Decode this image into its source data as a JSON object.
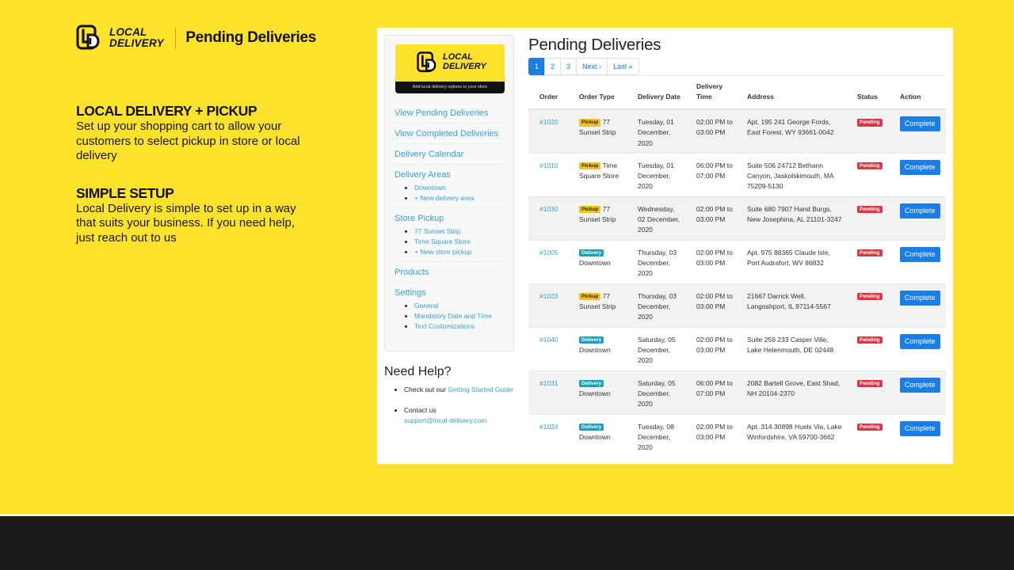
{
  "brand": {
    "logo_text_line1": "LOCAL",
    "logo_text_line2": "DELIVERY",
    "title": "Pending Deliveries"
  },
  "features": [
    {
      "heading": "LOCAL DELIVERY + PICKUP",
      "body": "Set up your shopping cart to allow your customers to select pickup in store or local delivery"
    },
    {
      "heading": "SIMPLE SETUP",
      "body": "Local Delivery is simple to set up in a way that suits your business. If you need help, just reach out to us"
    }
  ],
  "app": {
    "sidebar_logo": {
      "line1": "LOCAL",
      "line2": "DELIVERY",
      "tagline": "Add local delivery options to your store"
    },
    "nav": [
      {
        "label": "View Pending Deliveries",
        "children": []
      },
      {
        "label": "View Completed Deliveries",
        "children": []
      },
      {
        "label": "Delivery Calendar",
        "children": []
      },
      {
        "label": "Delivery Areas",
        "children": [
          "Downtown",
          "+ New delivery area"
        ]
      },
      {
        "label": "Store Pickup",
        "children": [
          "77 Sunset Strip",
          "Time Square Store",
          "+ New store pickup"
        ]
      },
      {
        "label": "Products",
        "children": []
      },
      {
        "label": "Settings",
        "children": [
          "General",
          "Mandatory Date and Time",
          "Text Customizations"
        ]
      }
    ],
    "help": {
      "title": "Need Help?",
      "item1_prefix": "Check out our ",
      "item1_link": "Getting Started Guide",
      "item2_prefix": "Contact us",
      "item2_link": "support@local-delivery.com"
    },
    "page_title": "Pending Deliveries",
    "pagination": {
      "pages": [
        "1",
        "2",
        "3"
      ],
      "active": "1",
      "next": "Next ›",
      "last": "Last »"
    },
    "table": {
      "headers": [
        "Order",
        "Order Type",
        "Delivery Date",
        "Delivery Time",
        "Address",
        "Status",
        "Action"
      ],
      "rows": [
        {
          "order": "#1020",
          "type": "Pickup",
          "type_detail": "77 Sunset Strip",
          "date": "Tuesday, 01 December, 2020",
          "time": "02:00 PM to 03:00 PM",
          "address": "Apt. 195 241 George Fords, East Forest, WY 93661-0042",
          "status": "Pending",
          "action": "Complete"
        },
        {
          "order": "#1010",
          "type": "Pickup",
          "type_detail": "Time Square Store",
          "date": "Tuesday, 01 December, 2020",
          "time": "06:00 PM to 07:00 PM",
          "address": "Suite 506 24712 Bethann Canyon, Jaskolskimouth, MA 75209-5130",
          "status": "Pending",
          "action": "Complete"
        },
        {
          "order": "#1030",
          "type": "Pickup",
          "type_detail": "77 Sunset Strip",
          "date": "Wednesday, 02 December, 2020",
          "time": "02:00 PM to 03:00 PM",
          "address": "Suite 680 7907 Hand Burgs, New Josephina, AL 21101-3247",
          "status": "Pending",
          "action": "Complete"
        },
        {
          "order": "#1005",
          "type": "Delivery",
          "type_detail": "Downtown",
          "date": "Thursday, 03 December, 2020",
          "time": "02:00 PM to 03:00 PM",
          "address": "Apt. 975 88365 Claude Isle, Port Audrafort, WV 86832",
          "status": "Pending",
          "action": "Complete"
        },
        {
          "order": "#1023",
          "type": "Pickup",
          "type_detail": "77 Sunset Strip",
          "date": "Thursday, 03 December, 2020",
          "time": "02:00 PM to 03:00 PM",
          "address": "21667 Darrick Well, Langoshport, IL 97114-5567",
          "status": "Pending",
          "action": "Complete"
        },
        {
          "order": "#1040",
          "type": "Delivery",
          "type_detail": "Downtown",
          "date": "Saturday, 05 December, 2020",
          "time": "02:00 PM to 03:00 PM",
          "address": "Suite 259 233 Casper Ville, Lake Helenmouth, DE 02448",
          "status": "Pending",
          "action": "Complete"
        },
        {
          "order": "#1031",
          "type": "Delivery",
          "type_detail": "Downtown",
          "date": "Saturday, 05 December, 2020",
          "time": "06:00 PM to 07:00 PM",
          "address": "2082 Bartell Grove, East Shad, NH 20104-2370",
          "status": "Pending",
          "action": "Complete"
        },
        {
          "order": "#1024",
          "type": "Delivery",
          "type_detail": "Downtown",
          "date": "Tuesday, 08 December, 2020",
          "time": "02:00 PM to 03:00 PM",
          "address": "Apt. 314 30898 Huels Via, Lake Winfordshire, VA 59700-3662",
          "status": "Pending",
          "action": "Complete"
        }
      ]
    }
  },
  "colors": {
    "background": "#FFE22B",
    "footer": "#1C1C1C",
    "link": "#3A9FD0",
    "primary": "#1A7EE6",
    "pickup_badge": "#F5C21B",
    "delivery_badge": "#17A2B8",
    "pending_badge": "#DC3545"
  }
}
